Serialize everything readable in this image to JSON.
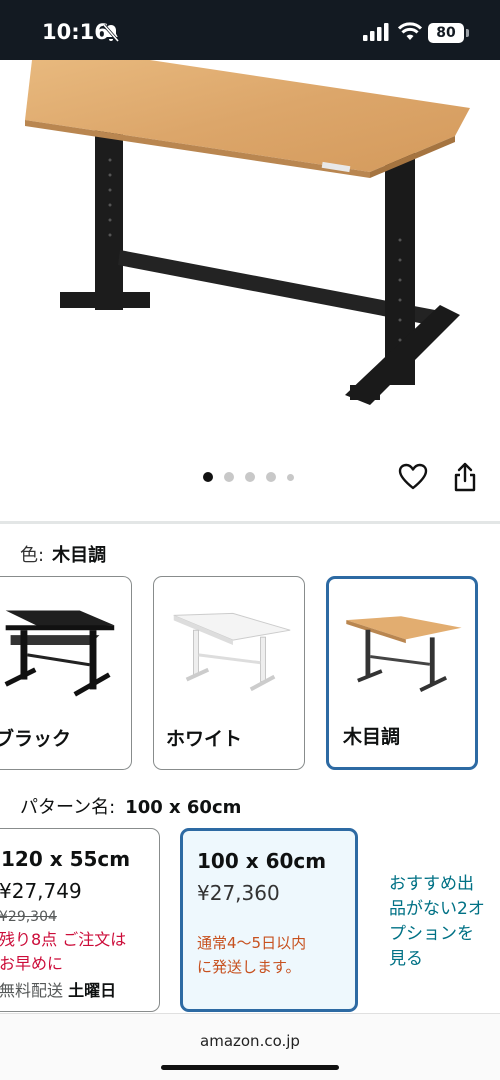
{
  "status_bar": {
    "time": "10:16",
    "battery": "80"
  },
  "carousel": {
    "total_dots": 5,
    "active_index": 0
  },
  "color": {
    "label": "色:",
    "selected": "木目調",
    "options": [
      {
        "label": "ブラック",
        "selected": false
      },
      {
        "label": "ホワイト",
        "selected": false
      },
      {
        "label": "木目調",
        "selected": true
      }
    ]
  },
  "pattern": {
    "label": "パターン名:",
    "selected": "100 x 60cm",
    "options": [
      {
        "size": "120 x 55cm",
        "price": "¥27,749",
        "list_price": "¥29,304",
        "stock_line1": "残り8点 ご注文は",
        "stock_line2": "お早めに",
        "shipping": "無料配送",
        "shipping_day": "土曜日"
      },
      {
        "size": "100 x 60cm",
        "price": "¥27,360",
        "delivery_line1": "通常4〜5日以内",
        "delivery_line2": "に発送します。"
      }
    ],
    "recommendation": [
      "おすすめ出",
      "品がない2オ",
      "プションを",
      "見る"
    ]
  },
  "colors": {
    "accent": "#2d6aa3",
    "link": "#007185",
    "alert": "#cc0c39",
    "delivery": "#c7511f"
  },
  "browser": {
    "url": "amazon.co.jp"
  }
}
